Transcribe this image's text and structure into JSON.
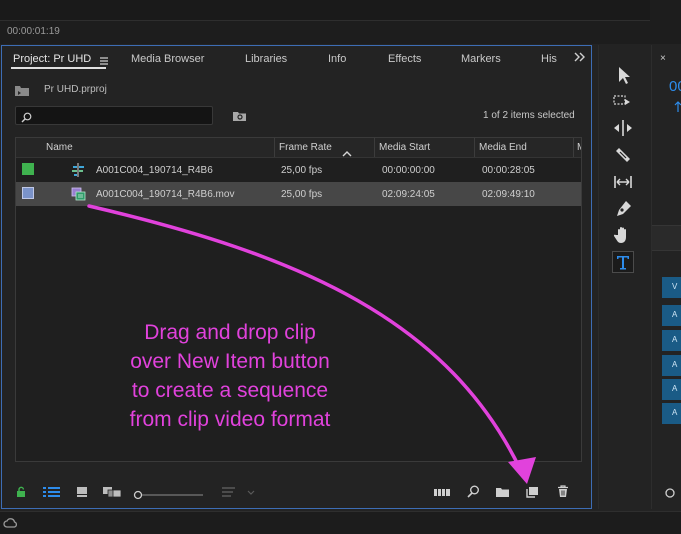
{
  "topbar": {
    "timecode": "00:00:01:19"
  },
  "project_panel": {
    "tabs": [
      {
        "label": "Project: Pr UHD",
        "menu_icon": "hamburger-icon"
      },
      {
        "label": "Media Browser"
      },
      {
        "label": "Libraries"
      },
      {
        "label": "Info"
      },
      {
        "label": "Effects"
      },
      {
        "label": "Markers"
      },
      {
        "label": "His"
      }
    ],
    "more_tabs_icon": "chevrons-right-icon",
    "project_file": "Pr UHD.prproj",
    "search": {
      "value": "",
      "placeholder": ""
    },
    "items_selected": "1 of 2 items selected",
    "columns": [
      "Name",
      "Frame Rate",
      "Media Start",
      "Media End"
    ],
    "sort": {
      "column": "Frame Rate",
      "direction": "ascending"
    },
    "rows": [
      {
        "color": "#3fb24f",
        "icon": "sequence-icon",
        "name": "A001C004_190714_R4B6",
        "frame_rate": "25,00 fps",
        "media_start": "00:00:00:00",
        "media_end": "00:00:28:05",
        "selected": false
      },
      {
        "color": "#7b93c9",
        "icon": "clip-icon",
        "name": "A001C004_190714_R4B6.mov",
        "frame_rate": "25,00 fps",
        "media_start": "02:09:24:05",
        "media_end": "02:09:49:10",
        "selected": true
      }
    ]
  },
  "annotation": {
    "lines": [
      "Drag and drop clip",
      "over New Item button",
      "to create a sequence",
      "from clip video format"
    ],
    "color": "#e142dc"
  },
  "bottom_toolbar": {
    "left": [
      "lock-icon",
      "list-view-icon",
      "icon-view-icon",
      "freeform-view-icon",
      "zoom-slider",
      "sort-icon"
    ],
    "right": [
      "automate-to-sequence-icon",
      "find-icon",
      "new-bin-icon",
      "new-item-icon",
      "clear-icon"
    ]
  },
  "tools": [
    "selection-tool-icon",
    "track-select-tool-icon",
    "ripple-edit-tool-icon",
    "razor-tool-icon",
    "slip-tool-icon",
    "pen-tool-icon",
    "hand-tool-icon",
    "type-tool-icon"
  ],
  "right_panel": {
    "timecode_fragment": "00",
    "tracks": [
      "V",
      "A",
      "A",
      "A",
      "A",
      "A"
    ]
  },
  "colors": {
    "focus_border": "#3d6db5",
    "accent_blue": "#2d8ceb",
    "selected_row": "#474747",
    "track": "#1a5b86"
  }
}
